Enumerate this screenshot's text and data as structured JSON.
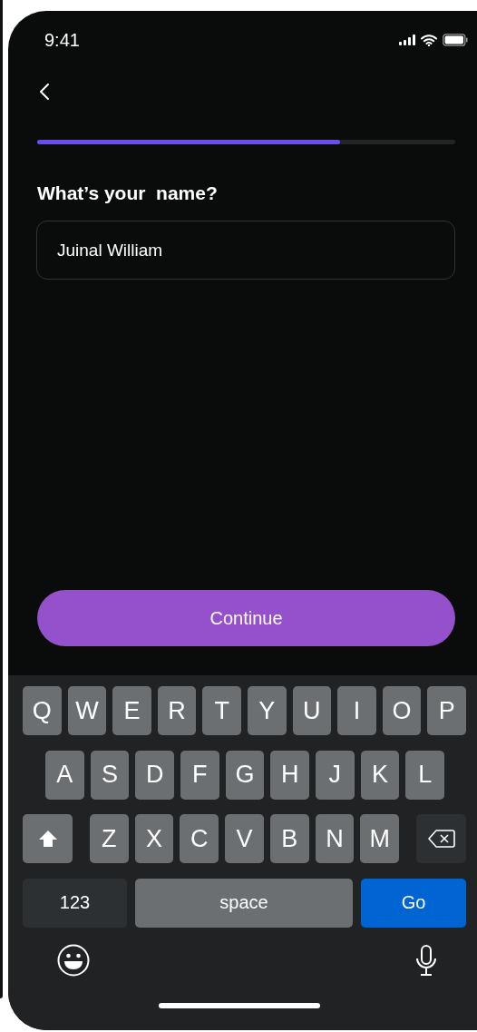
{
  "status_bar": {
    "time": "9:41"
  },
  "progress": {
    "level": 0.725
  },
  "title": "What’s your  name?",
  "name_field": {
    "value": "Juinal William"
  },
  "continue_button": {
    "label": "Continue"
  },
  "keyboard": {
    "letter_rows": [
      [
        "Q",
        "W",
        "E",
        "R",
        "T",
        "Y",
        "U",
        "I",
        "O",
        "P"
      ],
      [
        "A",
        "S",
        "D",
        "F",
        "G",
        "H",
        "J",
        "K",
        "L"
      ],
      [
        "Z",
        "X",
        "C",
        "V",
        "B",
        "N",
        "M"
      ]
    ],
    "numbers_key": "123",
    "space_key": "space",
    "go_key": "Go"
  }
}
